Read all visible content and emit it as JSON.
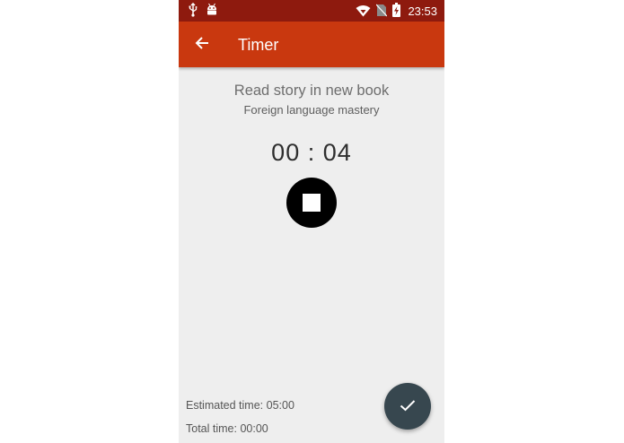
{
  "status_bar": {
    "time": "23:53",
    "left_icons": [
      "usb-icon",
      "android-debug-icon"
    ],
    "right_icons": [
      "wifi-icon",
      "no-sim-icon",
      "battery-charging-icon"
    ]
  },
  "toolbar": {
    "title": "Timer",
    "back_icon": "arrow-back-icon"
  },
  "task": {
    "title": "Read story in new book",
    "subtitle": "Foreign language mastery"
  },
  "timer": {
    "minutes": "00",
    "separator": ":",
    "seconds": "04"
  },
  "stop_button": {
    "icon": "stop-icon"
  },
  "summary": {
    "estimated_label": "Estimated time:",
    "estimated_value": "05:00",
    "total_label": "Total time:",
    "total_value": "00:00"
  },
  "fab": {
    "icon": "check-icon"
  },
  "colors": {
    "status_bar": "#8e1a0e",
    "toolbar": "#c9380f",
    "background": "#eeeeee",
    "fab": "#37474f",
    "stop_button": "#000000"
  }
}
